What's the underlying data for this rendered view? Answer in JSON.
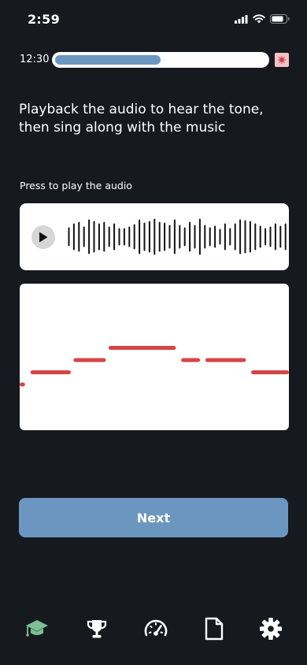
{
  "status_bar": {
    "time": "2:59"
  },
  "progress": {
    "timer": "12:30",
    "fraction": 0.5
  },
  "instruction": "Playback the audio to hear the tone, then sing along with the music",
  "audio": {
    "prompt": "Press to play the audio"
  },
  "pitch_notes": [
    {
      "pitch": 0,
      "start": 0,
      "end": 0.02
    },
    {
      "pitch": 1,
      "start": 0.04,
      "end": 0.19
    },
    {
      "pitch": 2,
      "start": 0.2,
      "end": 0.32
    },
    {
      "pitch": 3,
      "start": 0.33,
      "end": 0.58
    },
    {
      "pitch": 2,
      "start": 0.6,
      "end": 0.67
    },
    {
      "pitch": 2,
      "start": 0.69,
      "end": 0.84
    },
    {
      "pitch": 1,
      "start": 0.86,
      "end": 1.0
    }
  ],
  "next_button": {
    "label": "Next"
  },
  "tabs": [
    {
      "name": "learn",
      "icon": "graduation-cap-icon",
      "active": true
    },
    {
      "name": "achievements",
      "icon": "trophy-icon",
      "active": false
    },
    {
      "name": "progress",
      "icon": "speedometer-icon",
      "active": false
    },
    {
      "name": "documents",
      "icon": "document-icon",
      "active": false
    },
    {
      "name": "settings",
      "icon": "gear-icon",
      "active": false
    }
  ],
  "colors": {
    "background": "#161a1f",
    "accent": "#6b96c0",
    "note": "#d64545",
    "active_tab": "#7cc196",
    "flag": "#f2c2c6"
  }
}
